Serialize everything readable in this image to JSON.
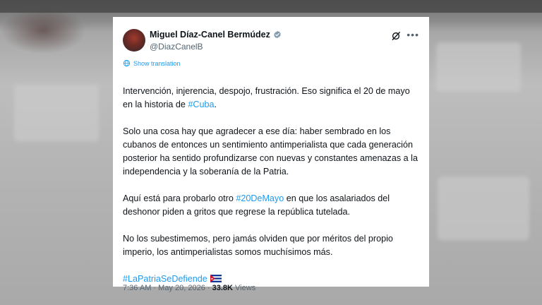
{
  "tweet": {
    "author_name": "Miguel Díaz-Canel Bermúdez",
    "handle": "@DiazCanelB",
    "show_translation": "Show translation",
    "p1_text": "Intervención, injerencia, despojo, frustración. Eso significa el 20 de mayo en la historia de ",
    "p1_link": "#Cuba",
    "p1_end": ".",
    "p2": "Solo una cosa hay que agradecer a ese día: haber sembrado en los cubanos de entonces un sentimiento antimperialista que cada generación posterior ha sentido profundizarse con nuevas y constantes amenazas a la independencia y la soberanía de la Patria.",
    "p3_text": "Aquí está para probarlo otro ",
    "p3_link": "#20DeMayo",
    "p3_end": " en que los asalariados del deshonor piden a gritos que regrese la república tutelada.",
    "p4": "No los subestimemos, pero jamás olviden que por méritos del propio imperio, los antimperialistas somos muchísimos más.",
    "hashtag": "#LaPatriaSeDefiende",
    "time": "7:36 AM",
    "separator": "·",
    "date": "May 20, 2026",
    "views_count": "33.8K",
    "views_label": "Views"
  },
  "icons": {
    "verified": "verified-badge-icon",
    "grok": "grok-icon",
    "more": "more-icon",
    "translate": "globe-icon",
    "flag": "cuba-flag-icon"
  },
  "colors": {
    "link": "#1d9bf0",
    "text": "#0f1419",
    "muted": "#536471"
  }
}
